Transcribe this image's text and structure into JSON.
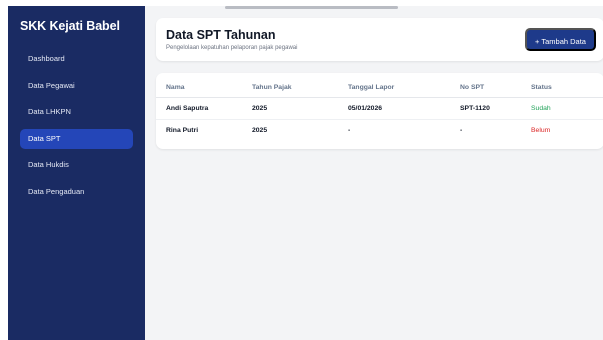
{
  "sidebar": {
    "brand": "SKK Kejati Babel",
    "items": [
      {
        "label": "Dashboard"
      },
      {
        "label": "Data Pegawai"
      },
      {
        "label": "Data LHKPN"
      },
      {
        "label": "Data SPT",
        "active": true
      },
      {
        "label": "Data Hukdis"
      },
      {
        "label": "Data Pengaduan"
      }
    ]
  },
  "header": {
    "title": "Data SPT Tahunan",
    "subtitle": "Pengelolaan kepatuhan pelaporan pajak pegawai",
    "add_button": "+ Tambah Data"
  },
  "table": {
    "columns": [
      "Nama",
      "Tahun Pajak",
      "Tanggal Lapor",
      "No SPT",
      "Status"
    ],
    "rows": [
      {
        "nama": "Andi Saputra",
        "tahun": "2025",
        "tanggal": "05/01/2026",
        "no_spt": "SPT-1120",
        "status": "Sudah"
      },
      {
        "nama": "Rina Putri",
        "tahun": "2025",
        "tanggal": "-",
        "no_spt": "-",
        "status": "Belum"
      }
    ]
  },
  "colors": {
    "sidebar_bg": "#1a2b63",
    "active_item": "#2446b8",
    "button_bg": "#1e3a8a",
    "status_done": "#22a35a",
    "status_pending": "#dc2626"
  }
}
